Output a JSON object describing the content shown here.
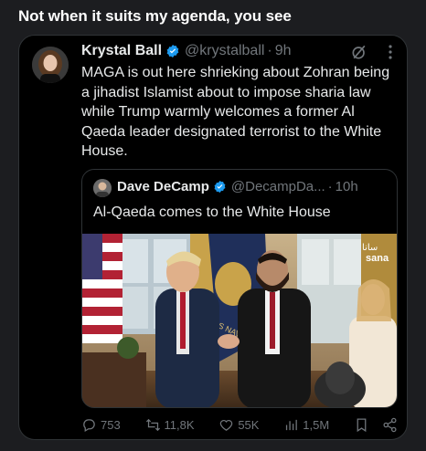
{
  "page": {
    "heading": "Not when it suits my agenda, you see"
  },
  "tweet": {
    "author_name": "Krystal Ball",
    "handle": "@krystalball",
    "separator": "·",
    "time": "9h",
    "text": "MAGA is out here shrieking about Zohran being a jihadist Islamist about to impose sharia law while Trump warmly welcomes a former Al Qaeda leader designated terrorist to the White House.",
    "verified_color": "#1d9bf0"
  },
  "quote": {
    "author_name": "Dave DeCamp",
    "handle": "@DecampDa...",
    "separator": "·",
    "time": "10h",
    "text": "Al-Qaeda comes to the White House",
    "image_watermark": "sana",
    "image_watermark_arabic": "سانا",
    "image_flag_text": "S NAVY"
  },
  "actions": {
    "replies": "753",
    "reposts": "11,8K",
    "likes": "55K",
    "views": "1,5M"
  },
  "icons": {
    "verified": "verified-badge-icon",
    "grok": "grok-icon",
    "more": "more-icon",
    "reply": "reply-icon",
    "repost": "repost-icon",
    "like": "heart-icon",
    "views": "views-icon",
    "bookmark": "bookmark-icon",
    "share": "share-icon"
  }
}
